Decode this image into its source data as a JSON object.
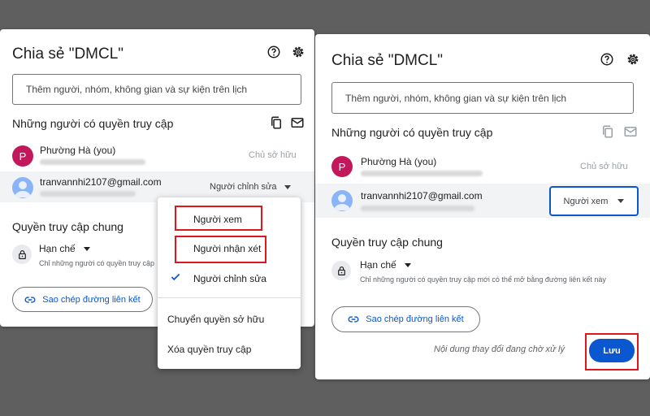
{
  "left_dialog": {
    "title": "Chia sẻ \"DMCL\"",
    "add_placeholder": "Thêm người, nhóm, không gian và sự kiện trên lịch",
    "people_header": "Những người có quyền truy cập",
    "owner": {
      "avatar_letter": "P",
      "name": "Phường Hà (you)",
      "role": "Chủ sở hữu"
    },
    "user": {
      "email": "tranvannhi2107@gmail.com",
      "role": "Người chỉnh sửa"
    },
    "general_header": "Quyền truy cập chung",
    "general_value": "Hạn chế",
    "general_desc": "Chỉ những người có quyền truy cập",
    "copy_link": "Sao chép đường liên kết"
  },
  "role_menu": {
    "viewer": "Người xem",
    "commenter": "Người nhận xét",
    "editor": "Người chỉnh sửa",
    "transfer": "Chuyển quyền sở hữu",
    "remove": "Xóa quyền truy cập",
    "selected": "Người chỉnh sửa"
  },
  "right_dialog": {
    "title": "Chia sẻ \"DMCL\"",
    "add_placeholder": "Thêm người, nhóm, không gian và sự kiện trên lịch",
    "people_header": "Những người có quyền truy cập",
    "owner": {
      "avatar_letter": "P",
      "name": "Phường Hà (you)",
      "role": "Chủ sở hữu"
    },
    "user": {
      "email": "tranvannhi2107@gmail.com",
      "role": "Người xem"
    },
    "general_header": "Quyền truy cập chung",
    "general_value": "Hạn chế",
    "general_desc": "Chỉ những người có quyền truy cập mới có thể mở bằng đường liên kết này",
    "copy_link": "Sao chép đường liên kết",
    "pending": "Nội dung thay đổi đang chờ xử lý",
    "save": "Lưu"
  },
  "colors": {
    "accent": "#0b57d0",
    "highlight": "#e0161b",
    "avatar": "#c2185b"
  }
}
